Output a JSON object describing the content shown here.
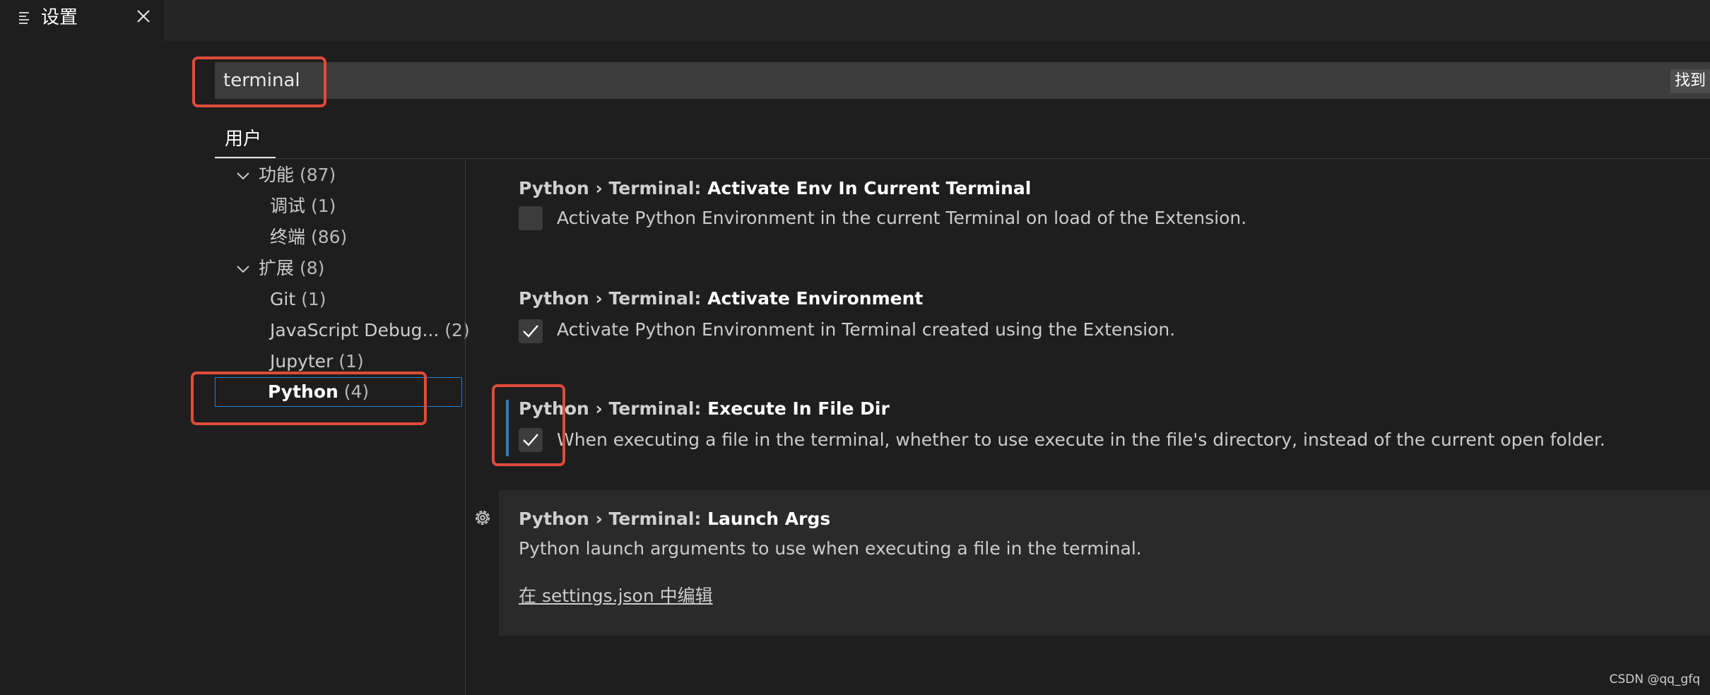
{
  "tab": {
    "title": "设置",
    "icon": "settings-list-icon",
    "close_icon": "close-icon"
  },
  "search": {
    "value": "terminal",
    "found_label": "找到"
  },
  "scope": {
    "user_tab": "用户"
  },
  "toc": {
    "features": {
      "label": "功能",
      "count": "(87)"
    },
    "debug": {
      "label": "调试",
      "count": "(1)"
    },
    "terminal": {
      "label": "终端",
      "count": "(86)"
    },
    "extensions": {
      "label": "扩展",
      "count": "(8)"
    },
    "git": {
      "label": "Git",
      "count": "(1)"
    },
    "js_debug": {
      "label": "JavaScript Debug...",
      "count": "(2)"
    },
    "jupyter": {
      "label": "Jupyter",
      "count": "(1)"
    },
    "python": {
      "label": "Python",
      "count": "(4)"
    }
  },
  "settings": [
    {
      "prefix": "Python › Terminal: ",
      "name": "Activate Env In Current Terminal",
      "description": "Activate Python Environment in the current Terminal on load of the Extension.",
      "checked": false
    },
    {
      "prefix": "Python › Terminal: ",
      "name": "Activate Environment",
      "description": "Activate Python Environment in Terminal created using the Extension.",
      "checked": true
    },
    {
      "prefix": "Python › Terminal: ",
      "name": "Execute In File Dir",
      "description": "When executing a file in the terminal, whether to use execute in the file's directory, instead of the current open folder.",
      "checked": true
    },
    {
      "prefix": "Python › Terminal: ",
      "name": "Launch Args",
      "description": "Python launch arguments to use when executing a file in the terminal.",
      "edit_link": "在 settings.json 中编辑"
    }
  ],
  "colors": {
    "annotation": "#e04a3a",
    "focus": "#2b7ebc"
  },
  "watermark": "CSDN @qq_gfq"
}
